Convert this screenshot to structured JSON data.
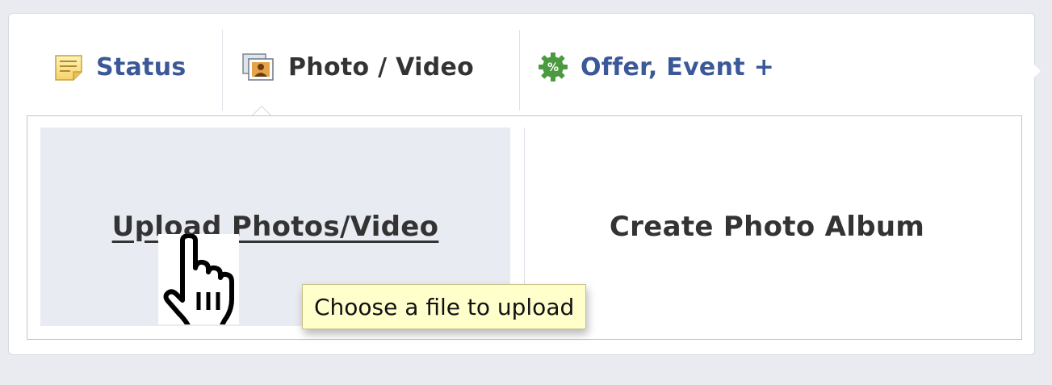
{
  "colors": {
    "link_blue": "#3b5998",
    "tab_active_text": "#333333",
    "hover_bg": "#e9ebf2",
    "tooltip_bg": "#ffffcc",
    "page_bg": "#e9ebf0"
  },
  "tabs": [
    {
      "label": "Status",
      "icon": "status-note-icon",
      "active": false
    },
    {
      "label": "Photo / Video",
      "icon": "photo-icon",
      "active": true
    },
    {
      "label": "Offer, Event +",
      "icon": "offer-gear-icon",
      "active": false
    }
  ],
  "options": {
    "upload_label": "Upload Photos/Video",
    "album_label": "Create Photo Album"
  },
  "cursor": {
    "icon": "hand-pointer-cursor-icon"
  },
  "tooltip": {
    "text": "Choose a file to upload"
  }
}
